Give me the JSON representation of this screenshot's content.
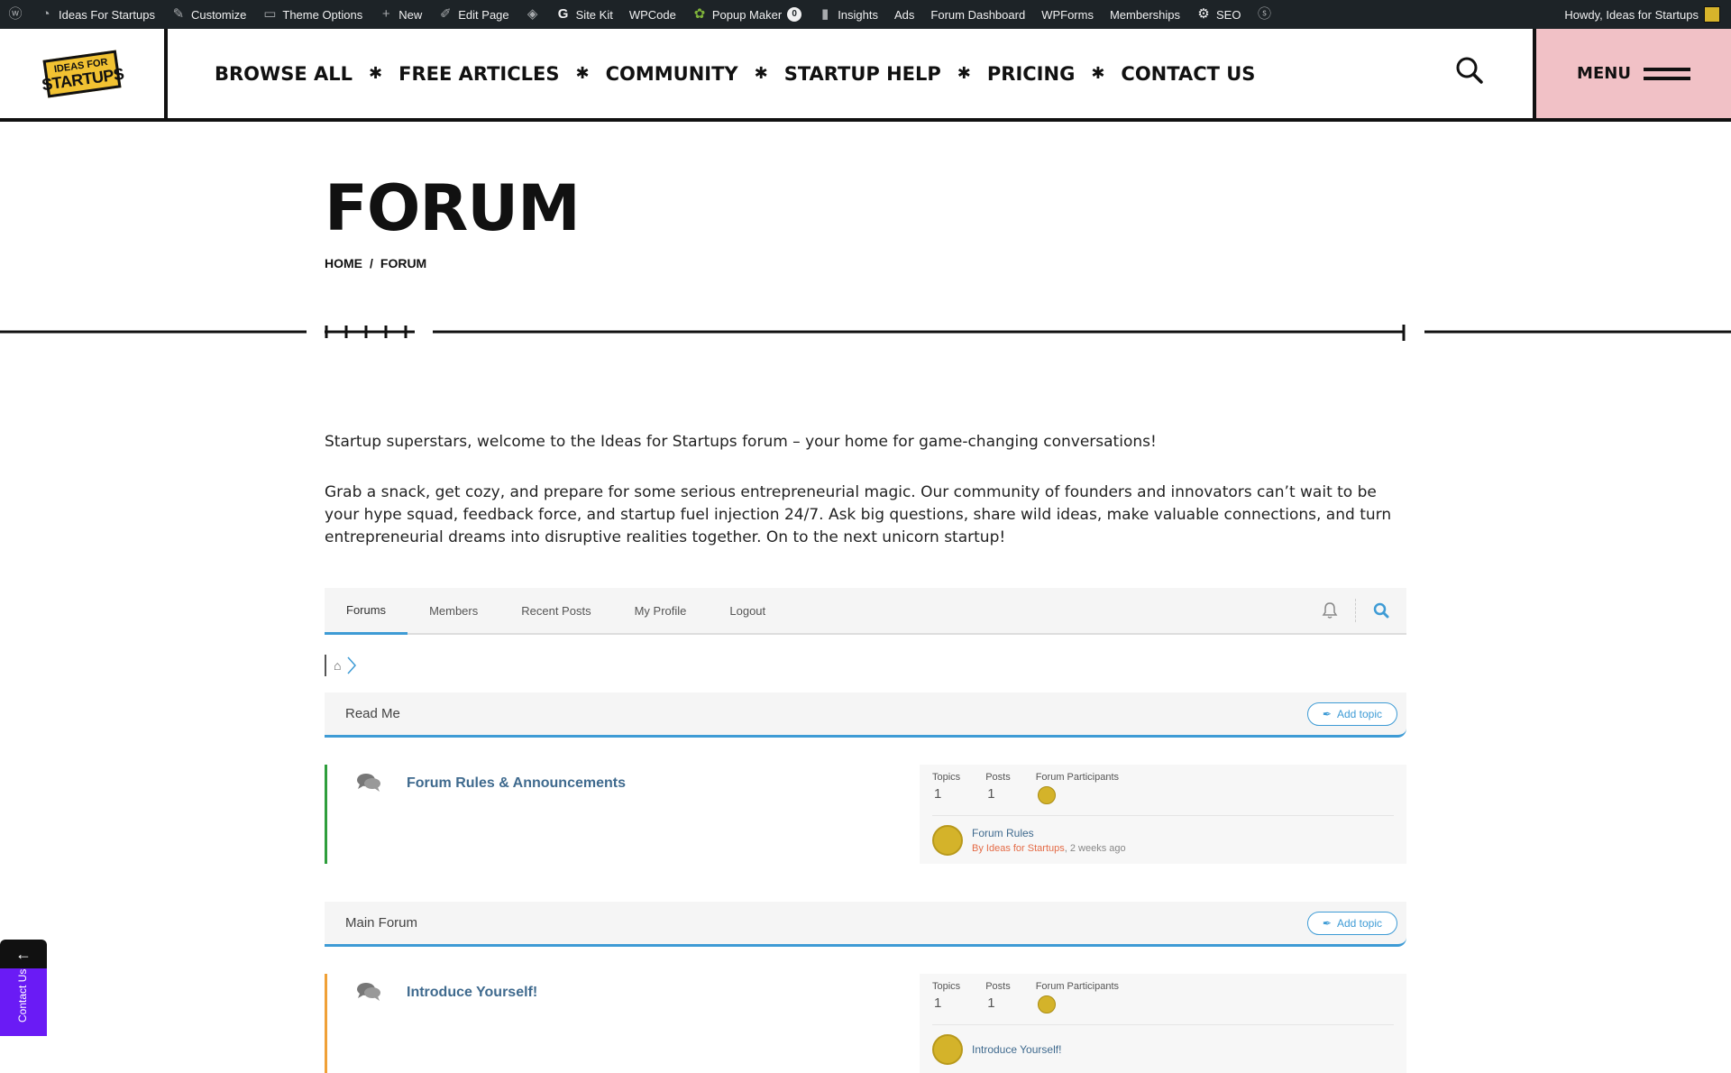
{
  "adminbar": {
    "site_name": "Ideas For Startups",
    "customize": "Customize",
    "theme_options": "Theme Options",
    "new": "New",
    "edit_page": "Edit Page",
    "site_kit": "Site Kit",
    "wpcode": "WPCode",
    "popup_maker": "Popup Maker",
    "popup_count": "0",
    "insights": "Insights",
    "ads": "Ads",
    "forum_dashboard": "Forum Dashboard",
    "wpforms": "WPForms",
    "memberships": "Memberships",
    "seo": "SEO",
    "howdy": "Howdy, Ideas for Startups"
  },
  "header": {
    "logo_line1": "IDEAS FOR",
    "logo_line2": "STARTUPS",
    "nav": [
      "BROWSE ALL",
      "FREE ARTICLES",
      "COMMUNITY",
      "STARTUP HELP",
      "PRICING",
      "CONTACT US"
    ],
    "separator": "✱",
    "menu_label": "MENU"
  },
  "page": {
    "title": "FORUM",
    "breadcrumb": {
      "home": "HOME",
      "sep": "/",
      "current": "FORUM"
    }
  },
  "intro": {
    "p1": "Startup superstars, welcome to the Ideas for Startups forum – your home for game-changing conversations!",
    "p2": "Grab a snack, get cozy, and prepare for some serious entrepreneurial magic. Our community of founders and innovators can’t wait to be your hype squad, feedback force, and startup fuel injection 24/7. Ask big questions, share wild ideas, make valuable connections, and turn entrepreneurial dreams into disruptive realities together. On to the next unicorn startup!"
  },
  "forum": {
    "tabs": [
      "Forums",
      "Members",
      "Recent Posts",
      "My Profile",
      "Logout"
    ],
    "add_topic": "Add topic",
    "stats_labels": {
      "topics": "Topics",
      "posts": "Posts",
      "participants": "Forum Participants"
    },
    "categories": [
      {
        "name": "Read Me",
        "forum_title": "Forum Rules & Announcements",
        "topics": "1",
        "posts": "1",
        "last_topic": "Forum Rules",
        "last_by_prefix": "By ",
        "last_author": "Ideas for Startups",
        "last_time": ", 2 weeks ago"
      },
      {
        "name": "Main Forum",
        "forum_title": "Introduce Yourself!",
        "topics": "1",
        "posts": "1",
        "last_topic": "Introduce Yourself!",
        "last_by_prefix": "",
        "last_author": "",
        "last_time": ""
      }
    ]
  },
  "side_widget": {
    "arrow": "←",
    "label": "Contact Us"
  },
  "colors": {
    "accent_blue": "#3e9bd5",
    "menu_pink": "#f1c1c6",
    "read_me_bar": "#2e9e3c",
    "main_forum_bar": "#f0a036",
    "contact_purple": "#6a1bf5"
  }
}
